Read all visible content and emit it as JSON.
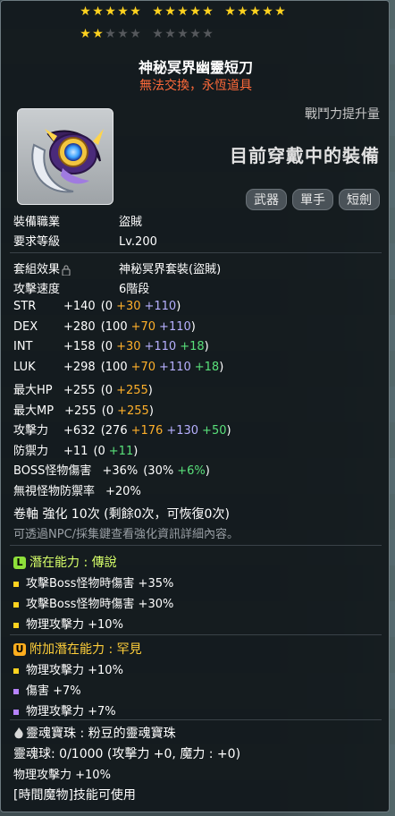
{
  "stars": {
    "filled": 17,
    "total": 25
  },
  "item": {
    "name": "神秘冥界幽靈短刀",
    "tag": "無法交換，永恆道具",
    "cp_label": "戰鬥力提升量",
    "equipped_text": "目前穿戴中的裝備",
    "chips": [
      "武器",
      "單手",
      "短劍"
    ]
  },
  "requirements": {
    "job_label": "裝備職業",
    "job_value": "盜賊",
    "level_label": "要求等級",
    "level_value": "Lv.200"
  },
  "set": {
    "label": "套組效果",
    "value": "神秘冥界套裝(盜賊)"
  },
  "attack_speed": {
    "label": "攻擊速度",
    "value": "6階段"
  },
  "stats": [
    {
      "name": "STR",
      "total": "+140",
      "base": "(0",
      "star": "+30",
      "flame": "+110",
      "extra": "",
      "close": ")"
    },
    {
      "name": "DEX",
      "total": "+280",
      "base": "(100",
      "star": "+70",
      "flame": "+110",
      "extra": "",
      "close": ")"
    },
    {
      "name": "INT",
      "total": "+158",
      "base": "(0",
      "star": "+30",
      "flame": "+110",
      "extra": "+18",
      "close": ")"
    },
    {
      "name": "LUK",
      "total": "+298",
      "base": "(100",
      "star": "+70",
      "flame": "+110",
      "extra": "+18",
      "close": ")"
    },
    {
      "name": "最大HP",
      "total": "+255",
      "base": "(0",
      "star": "+255",
      "flame": "",
      "extra": "",
      "close": ")"
    },
    {
      "name": "最大MP",
      "total": "+255",
      "base": "(0",
      "star": "+255",
      "flame": "",
      "extra": "",
      "close": ")"
    },
    {
      "name": "攻擊力",
      "total": "+632",
      "base": "(276",
      "star": "+176",
      "flame": "+130",
      "extra": "+50",
      "close": ")"
    },
    {
      "name": "防禦力",
      "total": "+11",
      "base": "(0",
      "star": "",
      "flame": "",
      "extra": "+11",
      "close": ")"
    },
    {
      "name": "BOSS怪物傷害",
      "total": "+36%",
      "base": "(30%",
      "star": "",
      "flame": "",
      "extra": "+6%",
      "close": ")"
    },
    {
      "name": "無視怪物防禦率",
      "total": "+20%",
      "base": "",
      "star": "",
      "flame": "",
      "extra": "",
      "close": ""
    }
  ],
  "scroll": {
    "line": "卷軸 強化 10次 (剩餘0次，可恢復0次)",
    "hint": "可透過NPC/採集鍵查看強化資訊詳細內容。"
  },
  "potential": {
    "title": "潛在能力 : 傳說",
    "lines": [
      "攻擊Boss怪物時傷害 +35%",
      "攻擊Boss怪物時傷害 +30%",
      "物理攻擊力 +10%"
    ]
  },
  "additional": {
    "title": "附加潛在能力 : 罕見",
    "lines": [
      "物理攻擊力 +10%",
      "傷害 +7%",
      "物理攻擊力 +7%"
    ]
  },
  "soul": {
    "title": "靈魂寶珠 : 粉豆的靈魂寶珠",
    "gauge": "靈魂球: 0/1000 (攻擊力 +0, 魔力 : +0)",
    "effect": "物理攻擊力 +10%",
    "skill": "[時間魔物]技能可使用"
  },
  "colors": {
    "star_on": "#ffd21f",
    "star_off": "#55585c",
    "tag": "#ff6a3a",
    "star_bonus": "#ffb02a",
    "flame_bonus": "#b7b0ff",
    "extra_bonus": "#59e07a",
    "legend": "#8ee03a",
    "unique": "#ffae1e"
  }
}
